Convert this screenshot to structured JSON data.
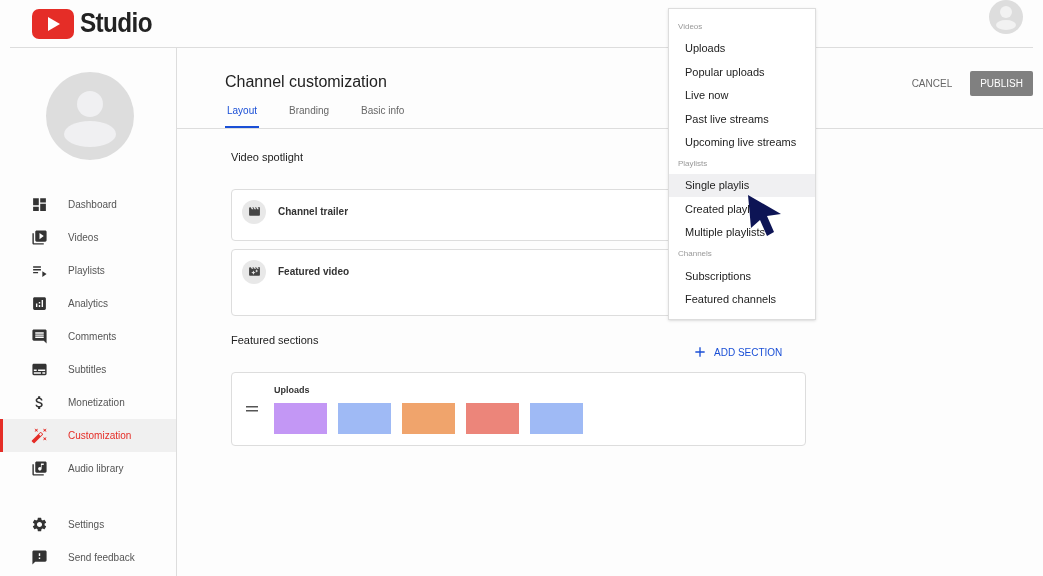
{
  "header": {
    "logo_text": "Studio"
  },
  "sidebar": {
    "items": [
      {
        "label": "Dashboard",
        "selected": false
      },
      {
        "label": "Videos",
        "selected": false
      },
      {
        "label": "Playlists",
        "selected": false
      },
      {
        "label": "Analytics",
        "selected": false
      },
      {
        "label": "Comments",
        "selected": false
      },
      {
        "label": "Subtitles",
        "selected": false
      },
      {
        "label": "Monetization",
        "selected": false
      },
      {
        "label": "Customization",
        "selected": true
      },
      {
        "label": "Audio library",
        "selected": false
      }
    ],
    "footer_items": [
      {
        "label": "Settings"
      },
      {
        "label": "Send feedback"
      }
    ]
  },
  "page": {
    "title": "Channel customization",
    "tabs": [
      {
        "label": "Layout",
        "selected": true
      },
      {
        "label": "Branding",
        "selected": false
      },
      {
        "label": "Basic info",
        "selected": false
      }
    ],
    "actions": {
      "cancel": "CANCEL",
      "publish": "PUBLISH"
    },
    "video_spotlight": {
      "heading": "Video spotlight",
      "cards": [
        {
          "label": "Channel trailer"
        },
        {
          "label": "Featured video"
        }
      ]
    },
    "featured_sections": {
      "heading": "Featured sections",
      "add_button": "ADD SECTION",
      "sections": [
        {
          "title": "Uploads",
          "thumbnails": [
            {
              "color": "#c397f5"
            },
            {
              "color": "#9fbaf5"
            },
            {
              "color": "#f0a46c"
            },
            {
              "color": "#ec857a"
            },
            {
              "color": "#9fbaf5"
            }
          ]
        }
      ]
    }
  },
  "add_section_menu": {
    "groups": [
      {
        "heading": "Videos",
        "items": [
          {
            "label": "Uploads",
            "selected": false
          },
          {
            "label": "Popular uploads",
            "selected": false
          },
          {
            "label": "Live now",
            "selected": false
          },
          {
            "label": "Past live streams",
            "selected": false
          },
          {
            "label": "Upcoming live streams",
            "selected": false
          }
        ]
      },
      {
        "heading": "Playlists",
        "items": [
          {
            "label": "Single playlis",
            "selected": true
          },
          {
            "label": "Created playl",
            "selected": false
          },
          {
            "label": "Multiple playlists",
            "selected": false
          }
        ]
      },
      {
        "heading": "Channels",
        "items": [
          {
            "label": "Subscriptions",
            "selected": false
          },
          {
            "label": "Featured channels",
            "selected": false
          }
        ]
      }
    ]
  }
}
